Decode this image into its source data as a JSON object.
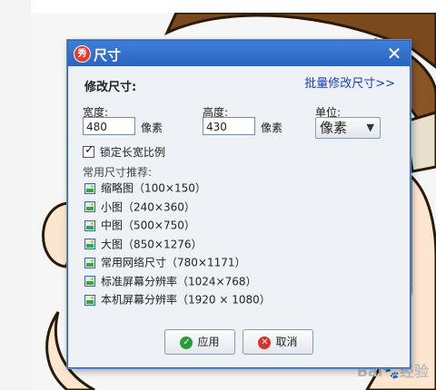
{
  "background": {
    "watermark_text": "Bai",
    "watermark_suffix": "经验"
  },
  "dialog": {
    "title": "尺寸",
    "badge_text": "秀",
    "close_glyph": "✕",
    "section_title": "修改尺寸:",
    "batch_link": "批量修改尺寸>>",
    "width_label": "宽度:",
    "width_value": "480",
    "width_unit": "像素",
    "height_label": "高度:",
    "height_value": "430",
    "height_unit": "像素",
    "unit_label": "单位:",
    "unit_selected": "像素",
    "lock_ratio_label": "锁定长宽比例",
    "lock_ratio_checked": true,
    "presets_title": "常用尺寸推荐:",
    "presets": [
      {
        "label": "缩略图（100×150）"
      },
      {
        "label": "小图（240×360）"
      },
      {
        "label": "中图（500×750）"
      },
      {
        "label": "大图（850×1276）"
      },
      {
        "label": "常用网络尺寸（780×1171）"
      },
      {
        "label": "标准屏幕分辨率（1024×768）"
      },
      {
        "label": "本机屏幕分辨率（1920 × 1080）"
      }
    ],
    "ok_label": "应用",
    "cancel_label": "取消"
  },
  "colors": {
    "titlebar": "#2f6fce",
    "dialog_bg": "#eef2f7",
    "link": "#1a3fb8",
    "ok_icon": "#2c9a3a",
    "cancel_icon": "#d8322a"
  }
}
